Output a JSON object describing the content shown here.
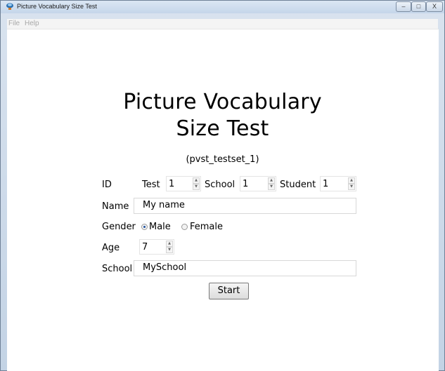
{
  "window": {
    "title": "Picture Vocabulary Size Test",
    "controls": {
      "minimize": "–",
      "maximize": "□",
      "close": "X"
    }
  },
  "menu": [
    "File",
    "Help"
  ],
  "heading": {
    "line1": "Picture Vocabulary",
    "line2": "Size Test"
  },
  "subtitle": "(pvst_testset_1)",
  "form": {
    "id_label": "ID",
    "test_label": "Test",
    "test_value": "1",
    "school_label": "School",
    "school_value": "1",
    "student_label": "Student",
    "student_value": "1",
    "name_label": "Name",
    "name_value": "My name",
    "gender_label": "Gender",
    "gender_options": [
      "Male",
      "Female"
    ],
    "gender_selected": "Male",
    "age_label": "Age",
    "age_value": "7",
    "school_name_label": "School",
    "school_name_value": "MySchool",
    "start_label": "Start"
  },
  "spinner_arrows": {
    "up": "▲",
    "down": "▼"
  }
}
